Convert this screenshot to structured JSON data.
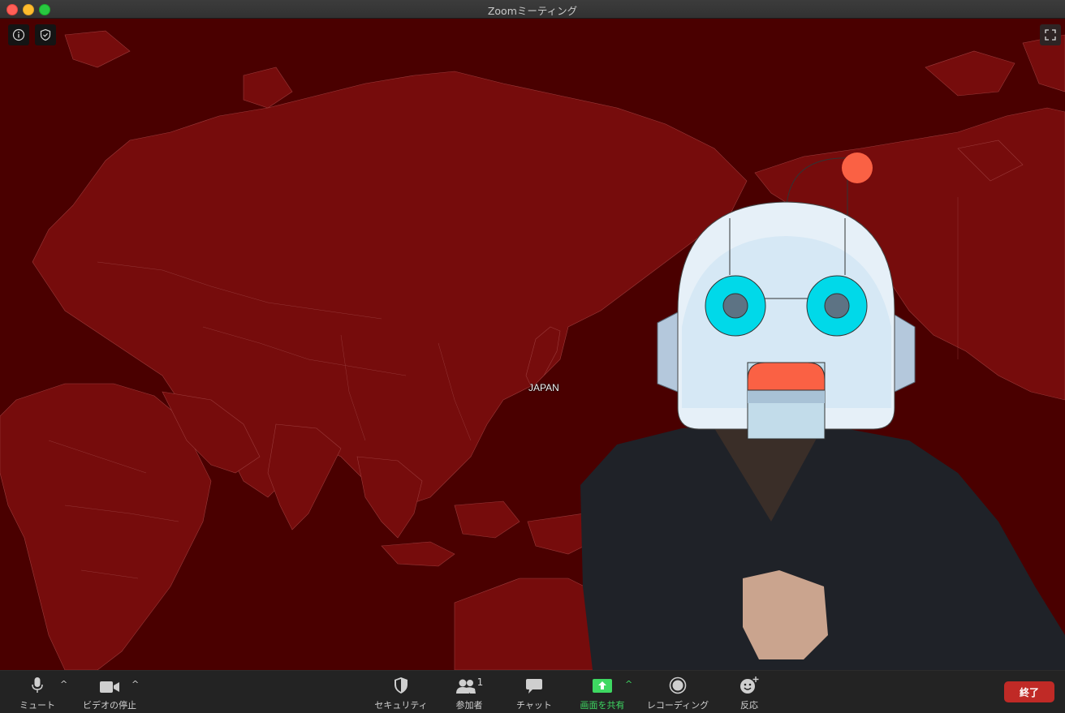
{
  "window": {
    "title": "Zoomミーティング"
  },
  "video": {
    "map_label": "JAPAN"
  },
  "toolbar": {
    "mute_label": "ミュート",
    "video_label": "ビデオの停止",
    "security_label": "セキュリティ",
    "participants_label": "参加者",
    "participants_count": "1",
    "chat_label": "チャット",
    "share_label": "画面を共有",
    "record_label": "レコーディング",
    "reactions_label": "反応",
    "end_label": "終了"
  },
  "colors": {
    "map_background": "#4a0000",
    "land": "#7a0f0f",
    "share_accent": "#3ed862",
    "end_button": "#c02a26"
  }
}
